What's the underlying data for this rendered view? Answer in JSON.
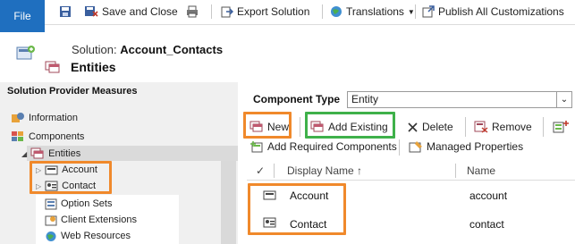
{
  "ribbon": {
    "file_label": "File",
    "save_close_label": "Save and Close",
    "export_label": "Export Solution",
    "translations_label": "Translations",
    "publish_label": "Publish All Customizations"
  },
  "header": {
    "solution_prefix": "Solution: ",
    "solution_name": "Account_Contacts",
    "page_title": "Entities"
  },
  "left_panel": {
    "title": "Solution Provider Measures",
    "tree": [
      {
        "label": "Information"
      },
      {
        "label": "Components"
      },
      {
        "label": "Entities"
      },
      {
        "label": "Account"
      },
      {
        "label": "Contact"
      },
      {
        "label": "Option Sets"
      },
      {
        "label": "Client Extensions"
      },
      {
        "label": "Web Resources"
      }
    ]
  },
  "component_type": {
    "label": "Component Type",
    "value": "Entity"
  },
  "toolbar": {
    "new_label": "New",
    "add_existing_label": "Add Existing",
    "delete_label": "Delete",
    "remove_label": "Remove",
    "add_required_label": "Add Required Components",
    "managed_props_label": "Managed Properties"
  },
  "grid": {
    "columns": [
      "Display Name ↑",
      "Name"
    ],
    "rows": [
      {
        "display_name": "Account",
        "name": "account"
      },
      {
        "display_name": "Contact",
        "name": "contact"
      }
    ]
  },
  "colors": {
    "file_blue": "#1f6fbf",
    "highlight_orange": "#f0892b",
    "highlight_green": "#3fb14a"
  }
}
